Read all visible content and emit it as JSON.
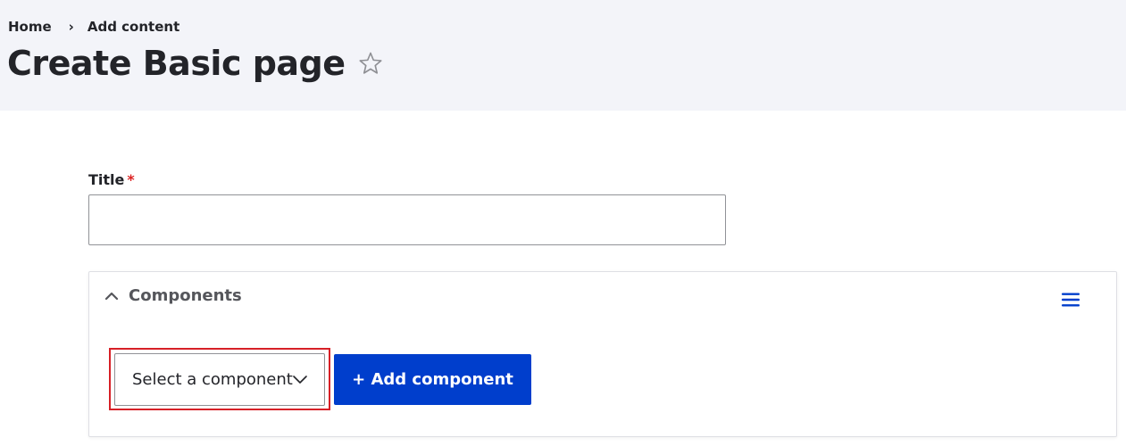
{
  "breadcrumb": {
    "items": [
      "Home",
      "Add content"
    ],
    "separator": "›"
  },
  "page": {
    "title": "Create Basic page",
    "favorite_icon": "star-outline-icon"
  },
  "form": {
    "title_label": "Title",
    "required_marker": "*",
    "title_value": ""
  },
  "components": {
    "section_label": "Components",
    "toggle_icon": "chevron-up-icon",
    "menu_icon": "hamburger-menu-icon",
    "select_value": "Select a component",
    "add_button_label": "+ Add component"
  },
  "colors": {
    "header_bg": "#f3f4f9",
    "primary_button": "#003ecc",
    "required": "#dc2323",
    "highlight": "#d72027",
    "menu_icon": "#003ecc"
  }
}
